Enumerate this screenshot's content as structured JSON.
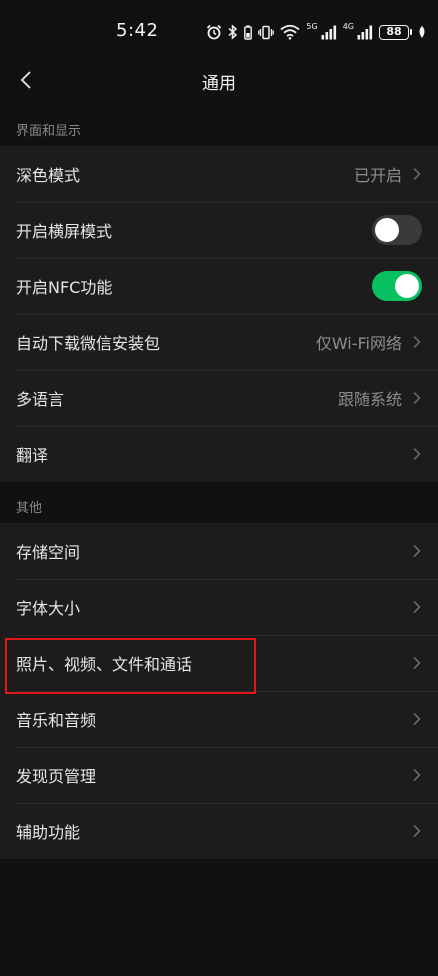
{
  "status_bar": {
    "time": "5:42",
    "signal1_label": "5G",
    "signal2_label": "4G",
    "battery": "88",
    "icons": [
      "alarm-icon",
      "bluetooth-icon",
      "vibrate-icon",
      "wifi-icon",
      "signal-icon",
      "signal-icon",
      "battery-icon",
      "leaf-icon"
    ]
  },
  "nav": {
    "title": "通用",
    "back_icon": "chevron-left-icon"
  },
  "section1": {
    "header": "界面和显示",
    "items": [
      {
        "label": "深色模式",
        "value": "已开启",
        "control": "chevron"
      },
      {
        "label": "开启横屏模式",
        "value": "",
        "control": "toggle",
        "on": false
      },
      {
        "label": "开启NFC功能",
        "value": "",
        "control": "toggle",
        "on": true
      },
      {
        "label": "自动下载微信安装包",
        "value": "仅Wi-Fi网络",
        "control": "chevron"
      },
      {
        "label": "多语言",
        "value": "跟随系统",
        "control": "chevron"
      },
      {
        "label": "翻译",
        "value": "",
        "control": "chevron"
      }
    ]
  },
  "section2": {
    "header": "其他",
    "items": [
      {
        "label": "存储空间",
        "value": "",
        "control": "chevron"
      },
      {
        "label": "字体大小",
        "value": "",
        "control": "chevron"
      },
      {
        "label": "照片、视频、文件和通话",
        "value": "",
        "control": "chevron",
        "highlighted": true
      },
      {
        "label": "音乐和音频",
        "value": "",
        "control": "chevron"
      },
      {
        "label": "发现页管理",
        "value": "",
        "control": "chevron"
      },
      {
        "label": "辅助功能",
        "value": "",
        "control": "chevron"
      }
    ]
  },
  "colors": {
    "background": "#111111",
    "group_background": "#1c1c1c",
    "toggle_on": "#07c160",
    "highlight": "#e0161b"
  }
}
